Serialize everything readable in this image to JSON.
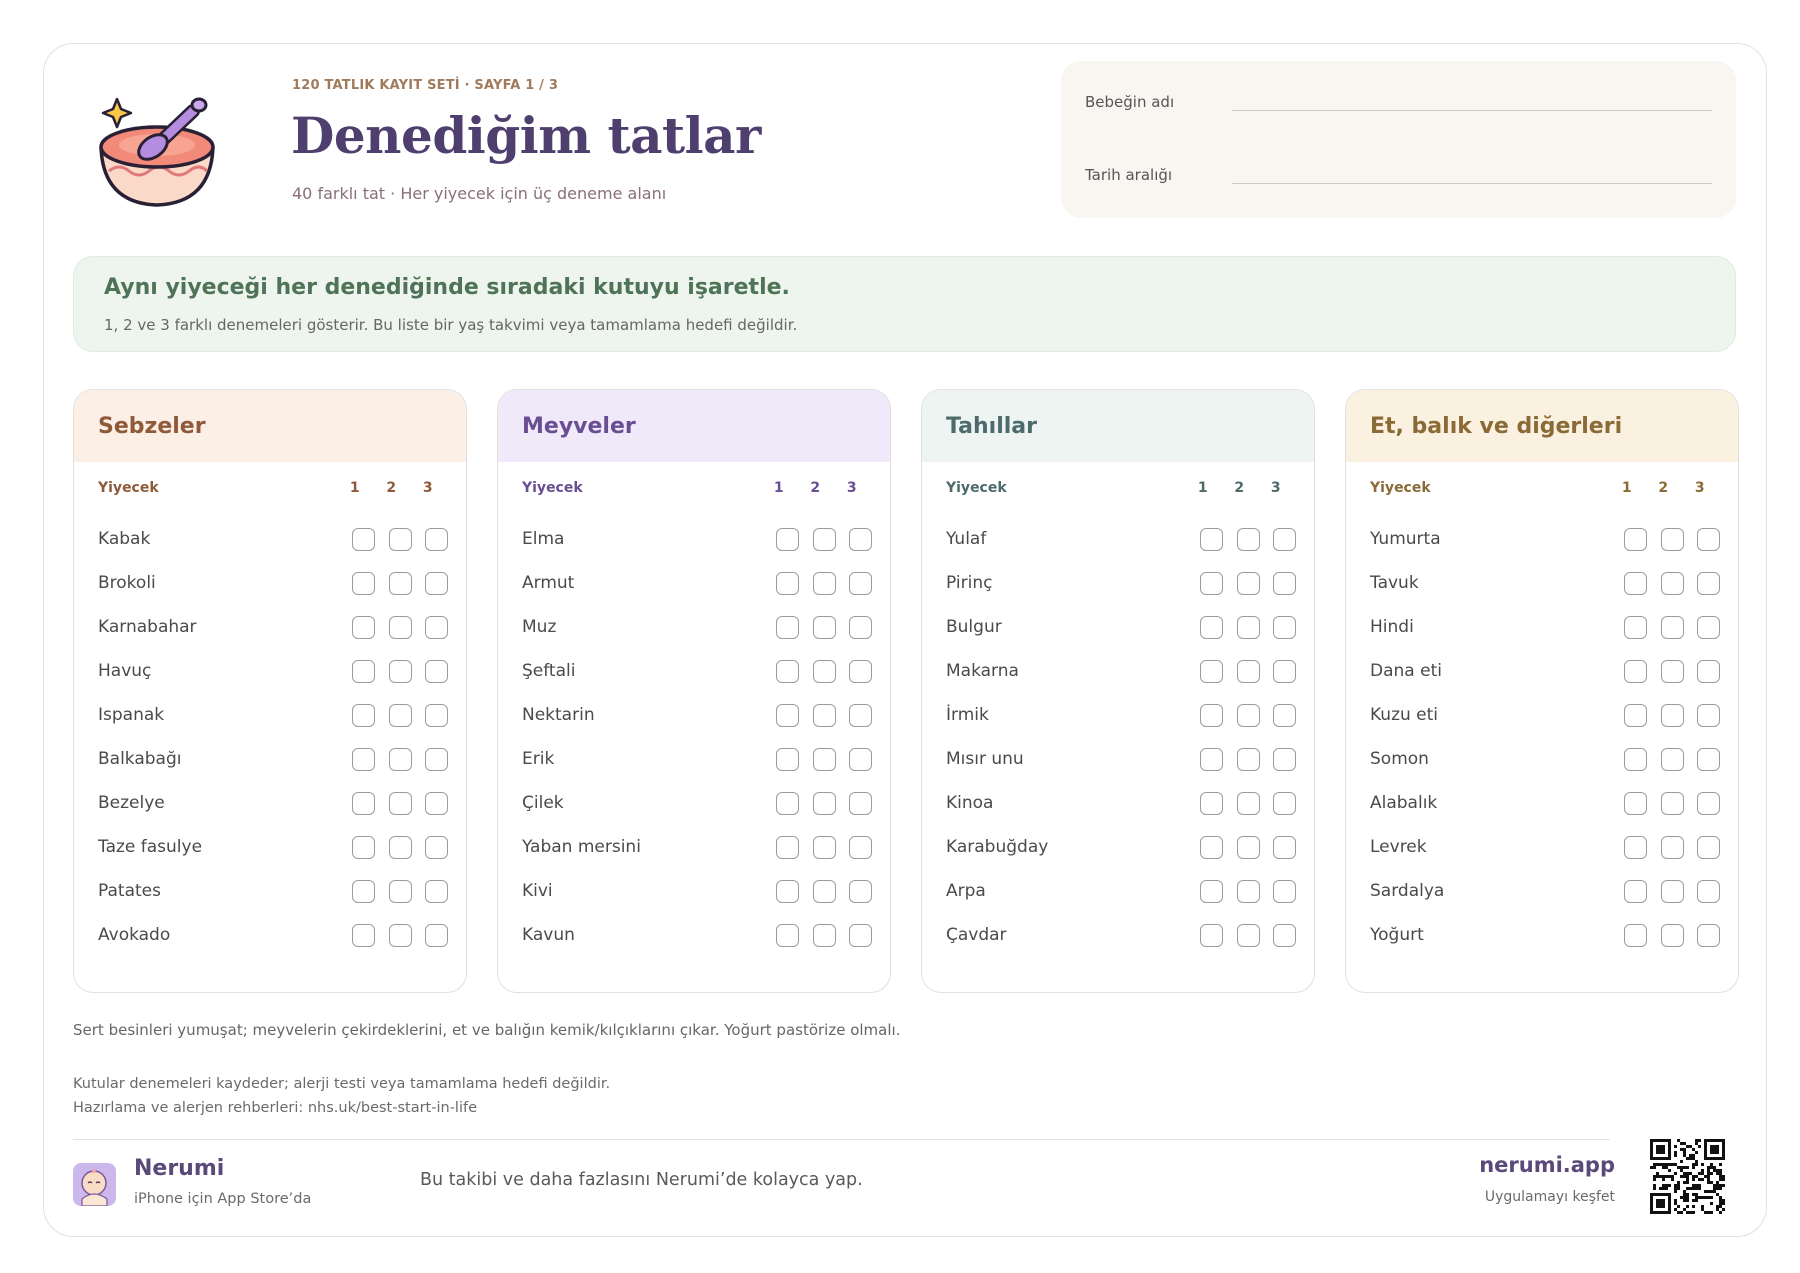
{
  "header": {
    "kicker": "120 TATLIK KAYIT SETİ · SAYFA 1 / 3",
    "title": "Denediğim tatlar",
    "subtitle": "40 farklı tat · Her yiyecek için üç deneme alanı"
  },
  "info": {
    "baby_name_label": "Bebeğin adı",
    "date_range_label": "Tarih aralığı"
  },
  "banner": {
    "title": "Aynı yiyeceği her denediğinde sıradaki kutuyu işaretle.",
    "text": "1, 2 ve 3 farklı denemeleri gösterir. Bu liste bir yaş takvimi veya tamamlama hedefi değildir."
  },
  "columns": [
    {
      "title": "Sebzeler",
      "caption": "Yiyecek",
      "numbers": [
        "1",
        "2",
        "3"
      ],
      "colors": {
        "head_bg": "#fcefe6",
        "head_text": "#8f5a3a",
        "sub_text": "#8f5a3a"
      },
      "items": [
        "Kabak",
        "Brokoli",
        "Karnabahar",
        "Havuç",
        "Ispanak",
        "Balkabağı",
        "Bezelye",
        "Taze fasulye",
        "Patates",
        "Avokado"
      ]
    },
    {
      "title": "Meyveler",
      "caption": "Yiyecek",
      "numbers": [
        "1",
        "2",
        "3"
      ],
      "colors": {
        "head_bg": "#efe9fa",
        "head_text": "#6a4e92",
        "sub_text": "#6a4e92"
      },
      "items": [
        "Elma",
        "Armut",
        "Muz",
        "Şeftali",
        "Nektarin",
        "Erik",
        "Çilek",
        "Yaban mersini",
        "Kivi",
        "Kavun"
      ]
    },
    {
      "title": "Tahıllar",
      "caption": "Yiyecek",
      "numbers": [
        "1",
        "2",
        "3"
      ],
      "colors": {
        "head_bg": "#edf4f1",
        "head_text": "#4c6b6a",
        "sub_text": "#4c6b6a"
      },
      "items": [
        "Yulaf",
        "Pirinç",
        "Bulgur",
        "Makarna",
        "İrmik",
        "Mısır unu",
        "Kinoa",
        "Karabuğday",
        "Arpa",
        "Çavdar"
      ]
    },
    {
      "title": "Et, balık ve diğerleri",
      "caption": "Yiyecek",
      "numbers": [
        "1",
        "2",
        "3"
      ],
      "colors": {
        "head_bg": "#fbf1e0",
        "head_text": "#8a6a36",
        "sub_text": "#8a6a36"
      },
      "items": [
        "Yumurta",
        "Tavuk",
        "Hindi",
        "Dana eti",
        "Kuzu eti",
        "Somon",
        "Alabalık",
        "Levrek",
        "Sardalya",
        "Yoğurt"
      ]
    }
  ],
  "notes": {
    "prep": "Sert besinleri yumuşat; meyvelerin çekirdeklerini, et ve balığın kemik/kılçıklarını çıkar. Yoğurt pastörize olmalı.",
    "disclaimer": "Kutular denemeleri kaydeder; alerji testi veya tamamlama hedefi değildir.",
    "guides": "Hazırlama ve alerjen rehberleri: nhs.uk/best-start-in-life"
  },
  "footer": {
    "brand": "Nerumi",
    "brand_sub": "iPhone için App Store’da",
    "promo": "Bu takibi ve daha fazlasını Nerumi’de kolayca yap.",
    "site": "nerumi.app",
    "site_sub": "Uygulamayı keşfet"
  },
  "icons": {
    "logo": "baby-food-bowl-icon",
    "app": "nerumi-app-icon",
    "qr": "qr-code-icon"
  }
}
